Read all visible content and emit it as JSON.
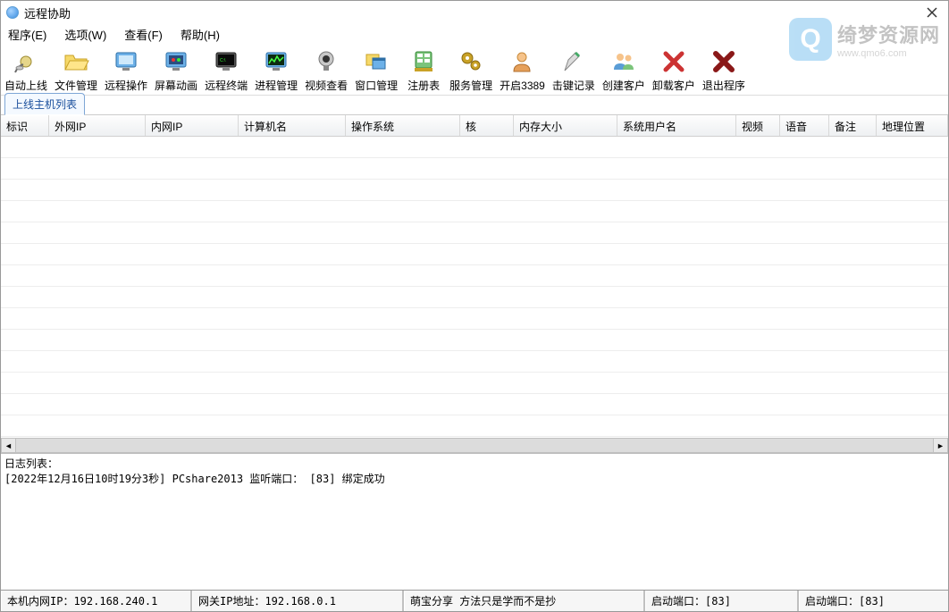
{
  "window": {
    "title": "远程协助"
  },
  "menu": {
    "program": "程序(E)",
    "options": "选项(W)",
    "view": "查看(F)",
    "help": "帮助(H)"
  },
  "toolbar": {
    "auto_online": "自动上线",
    "file_mgr": "文件管理",
    "remote_op": "远程操作",
    "screen_anim": "屏幕动画",
    "remote_term": "远程终端",
    "proc_mgr": "进程管理",
    "video_view": "视频查看",
    "win_mgr": "窗口管理",
    "registry": "注册表",
    "svc_mgr": "服务管理",
    "open_3389": "开启3389",
    "keylog": "击键记录",
    "create_client": "创建客户",
    "uninstall_client": "卸载客户",
    "exit": "退出程序"
  },
  "tab": {
    "hostlist": "上线主机列表"
  },
  "columns": {
    "flag": "标识",
    "wanip": "外网IP",
    "lanip": "内网IP",
    "hostname": "计算机名",
    "os": "操作系统",
    "core": "核",
    "memsize": "内存大小",
    "sysuser": "系统用户名",
    "video": "视频",
    "audio": "语音",
    "note": "备注",
    "geo": "地理位置"
  },
  "log": {
    "header": "日志列表：",
    "line1": "[2022年12月16日10时19分3秒]  PCshare2013  监听端口： [83] 绑定成功"
  },
  "status": {
    "lanip_label": "本机内网IP：",
    "lanip_value": "192.168.240.1",
    "gwip_label": "网关IP地址：",
    "gwip_value": "192.168.0.1",
    "share": "萌宝分享  方法只是学而不是抄",
    "port_label": "启动端口：",
    "port_value": "[83]",
    "port2_label": "启动端口：",
    "port2_value": "[83]"
  },
  "watermark": {
    "q": "Q",
    "main": "绮梦资源网",
    "sub": "www.qmo6.com"
  }
}
